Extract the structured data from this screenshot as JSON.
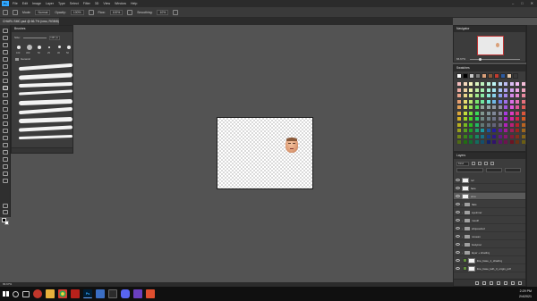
{
  "app": {
    "logo": "Ps",
    "menus": [
      "File",
      "Edit",
      "Image",
      "Layer",
      "Type",
      "Select",
      "Filter",
      "3D",
      "View",
      "Window",
      "Help"
    ],
    "window_controls": [
      "–",
      "□",
      "✕"
    ]
  },
  "options_bar": {
    "mode_label": "Mode:",
    "mode_value": "Normal",
    "opacity_label": "Opacity:",
    "opacity_value": "100%",
    "flow_label": "Flow:",
    "flow_value": "100%",
    "smoothing_label": "Smoothing:",
    "smoothing_value": "10%"
  },
  "document": {
    "tab_title": "CHARL SMC.psd @ 66.7% (vmo, RGB/8)"
  },
  "brushes_panel": {
    "title": "Brushes",
    "size_value": "130 px",
    "preset_sizes": [
      "100",
      "300",
      "50",
      "25",
      "30",
      "50"
    ],
    "folder_label": "General"
  },
  "navigator_panel": {
    "title": "Navigator",
    "zoom": "66.67%"
  },
  "swatches_panel": {
    "title": "Swatches"
  },
  "layers_panel": {
    "title": "Layers",
    "filter_kind": "Kind",
    "layers": [
      {
        "name": "ref",
        "type": "layer"
      },
      {
        "name": "face",
        "type": "layer"
      },
      {
        "name": "vmo",
        "type": "layer",
        "selected": true
      },
      {
        "name": "flats",
        "type": "group"
      },
      {
        "name": "eyeinner",
        "type": "group"
      },
      {
        "name": "mouth",
        "type": "group"
      },
      {
        "name": "eliqueeded",
        "type": "group"
      },
      {
        "name": "nosean",
        "type": "group"
      },
      {
        "name": "bodynsc",
        "type": "group"
      },
      {
        "name": "layer + shading",
        "type": "group"
      },
      {
        "name": "line_base_1_shading",
        "type": "layer"
      },
      {
        "name": "line_base_lath_3_origin_pdf",
        "type": "layer"
      }
    ]
  },
  "status_bar": {
    "zoom": "66.67%"
  },
  "taskbar": {
    "time": "2:29 PM",
    "date": "2/4/2021"
  },
  "colors": {
    "accent_blue": "#31a8ff",
    "selected_layer": "#5a5a5a",
    "panel_bg": "#3c3c3c",
    "workspace_bg": "#535353"
  }
}
